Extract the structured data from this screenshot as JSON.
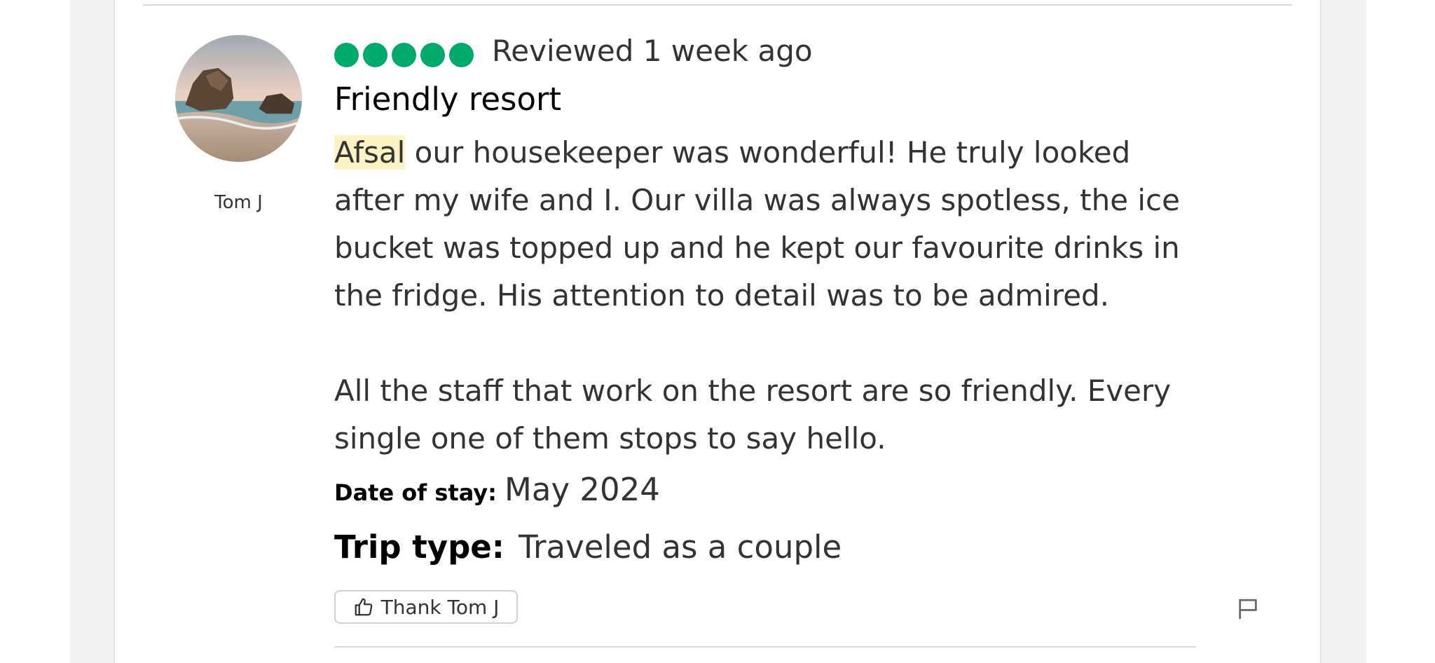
{
  "reviewer": {
    "name": "Tom J",
    "avatar_icon": "beach-rock-avatar"
  },
  "review": {
    "rating": 5,
    "rating_max": 5,
    "rating_color": "#00aa6c",
    "reviewed_label": "Reviewed 1 week ago",
    "title": "Friendly resort",
    "highlighted_name": "Afsal",
    "paragraph1_rest": " our housekeeper was wonderful! He truly looked after my wife and I. Our villa was always spotless, the ice bucket was topped up and he kept our favourite drinks in the fridge. His attention to detail was to be admired.",
    "paragraph2": "All the staff that work on the resort are so friendly. Every single one of them stops to say hello.",
    "date_of_stay_label": "Date of stay:",
    "date_of_stay_value": "May 2024",
    "trip_type_label": "Trip type:",
    "trip_type_value": "Traveled as a couple"
  },
  "actions": {
    "thank_label": "Thank Tom J",
    "thank_icon": "thumbs-up-icon",
    "report_icon": "flag-icon"
  }
}
